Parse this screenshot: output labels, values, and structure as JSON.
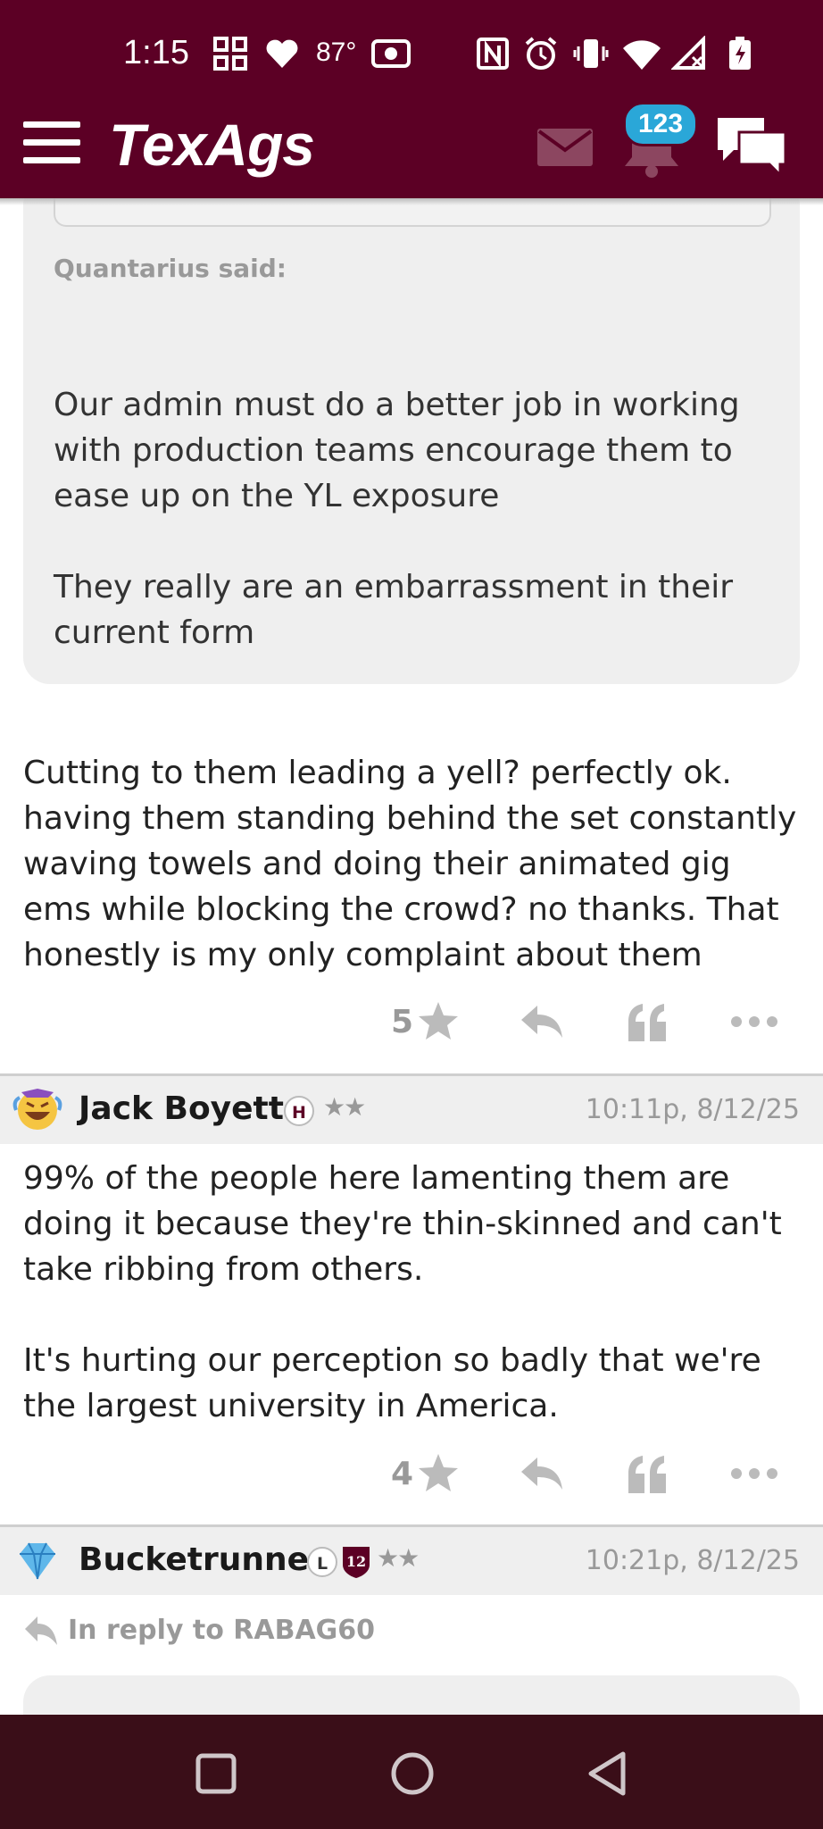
{
  "status_bar": {
    "time": "1:15",
    "temperature": "87°",
    "icons": [
      "grid-icon",
      "heart-icon",
      "camera-icon",
      "nfc-icon",
      "alarm-icon",
      "vibrate-icon",
      "wifi-icon",
      "signal-icon",
      "battery-icon"
    ]
  },
  "app_bar": {
    "logo": "TexAgs",
    "notification_count": "123",
    "colors": {
      "maroon": "#5c0025",
      "badge": "#2aa7d8"
    }
  },
  "quote": {
    "author": "Quantarius said:",
    "paragraphs": [
      "Our admin must do a better job in working with production teams encourage them to ease up on the YL exposure",
      "They really are an embarrassment in their current form"
    ]
  },
  "posts": [
    {
      "text": "Cutting to them leading a yell? perfectly ok. having them standing behind the set constantly waving towels and doing their animated gig ems while blocking the crowd? no thanks. That honestly is my only complaint about them",
      "rating": "5"
    },
    {
      "username": "Jack Boyette",
      "badge": "H",
      "stars": "★★",
      "timestamp": "10:11p, 8/12/25",
      "paragraphs": [
        "99% of the people here lamenting them are doing it because they're thin-skinned and can't take ribbing from others.",
        "It's hurting our perception so badly that we're the largest university in America."
      ],
      "rating": "4"
    },
    {
      "username": "Bucketrunner",
      "badge": "L",
      "shield": "12",
      "stars": "★★",
      "timestamp": "10:21p, 8/12/25",
      "in_reply_to": "In reply to RABAG60"
    }
  ]
}
